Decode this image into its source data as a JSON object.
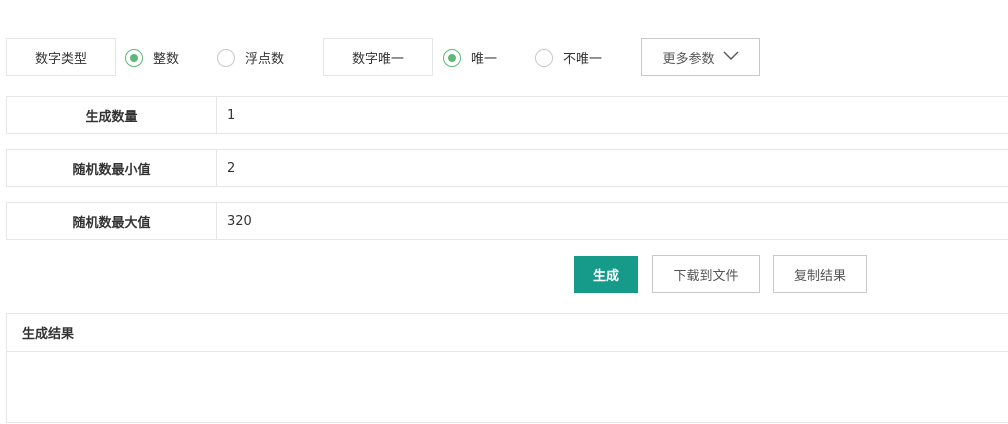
{
  "type_group": {
    "label": "数字类型",
    "options": [
      {
        "label": "整数",
        "checked": true
      },
      {
        "label": "浮点数",
        "checked": false
      }
    ]
  },
  "unique_group": {
    "label": "数字唯一",
    "options": [
      {
        "label": "唯一",
        "checked": true
      },
      {
        "label": "不唯一",
        "checked": false
      }
    ]
  },
  "more_params": {
    "label": "更多参数",
    "icon": "chevron-down-icon"
  },
  "fields": [
    {
      "label": "生成数量",
      "value": "1"
    },
    {
      "label": "随机数最小值",
      "value": "2"
    },
    {
      "label": "随机数最大值",
      "value": "320"
    }
  ],
  "actions": {
    "generate": "生成",
    "download": "下载到文件",
    "copy": "复制结果"
  },
  "result": {
    "title": "生成结果",
    "content": ""
  },
  "colors": {
    "accent": "#169b8b",
    "radio_checked": "#5fb878",
    "border": "#e6e6e6"
  }
}
